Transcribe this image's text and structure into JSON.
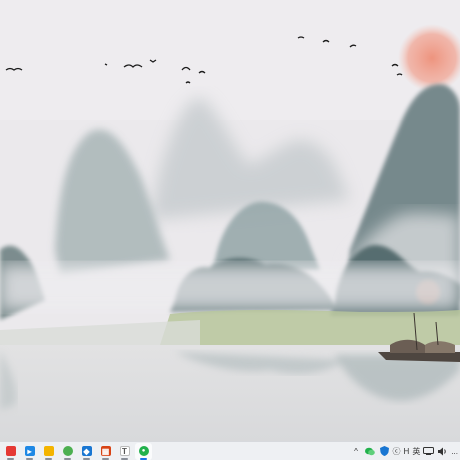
{
  "desktop": {
    "wallpaper_name": "ink-wash landscape",
    "colors": {
      "sky": "#ebe9ec",
      "sun": "#ef9a86",
      "mountain": "#7f9396",
      "water": "#d9dbdd",
      "grass": "#b9c79c"
    }
  },
  "taskbar": {
    "apps": [
      {
        "name": "app-red-icon",
        "glyph": "",
        "color": "#e53935"
      },
      {
        "name": "app-blue-arrow-icon",
        "glyph": "▸",
        "color": "#1e88e5"
      },
      {
        "name": "file-explorer-icon",
        "glyph": "",
        "color": "#f4b400"
      },
      {
        "name": "chrome-icon",
        "glyph": "",
        "color": "#4caf50"
      },
      {
        "name": "vscode-icon",
        "glyph": "◆",
        "color": "#1976d2"
      },
      {
        "name": "app-grid-icon",
        "glyph": "▦",
        "color": "#d84315"
      },
      {
        "name": "typora-icon",
        "glyph": "T",
        "color": "#555555"
      },
      {
        "name": "wechat-icon",
        "glyph": "●",
        "color": "#22b14c"
      }
    ],
    "tray": {
      "chevron": "^",
      "text_a": "ⓒ",
      "text_b": "H",
      "lang": "英",
      "clock_partial": "..."
    }
  }
}
